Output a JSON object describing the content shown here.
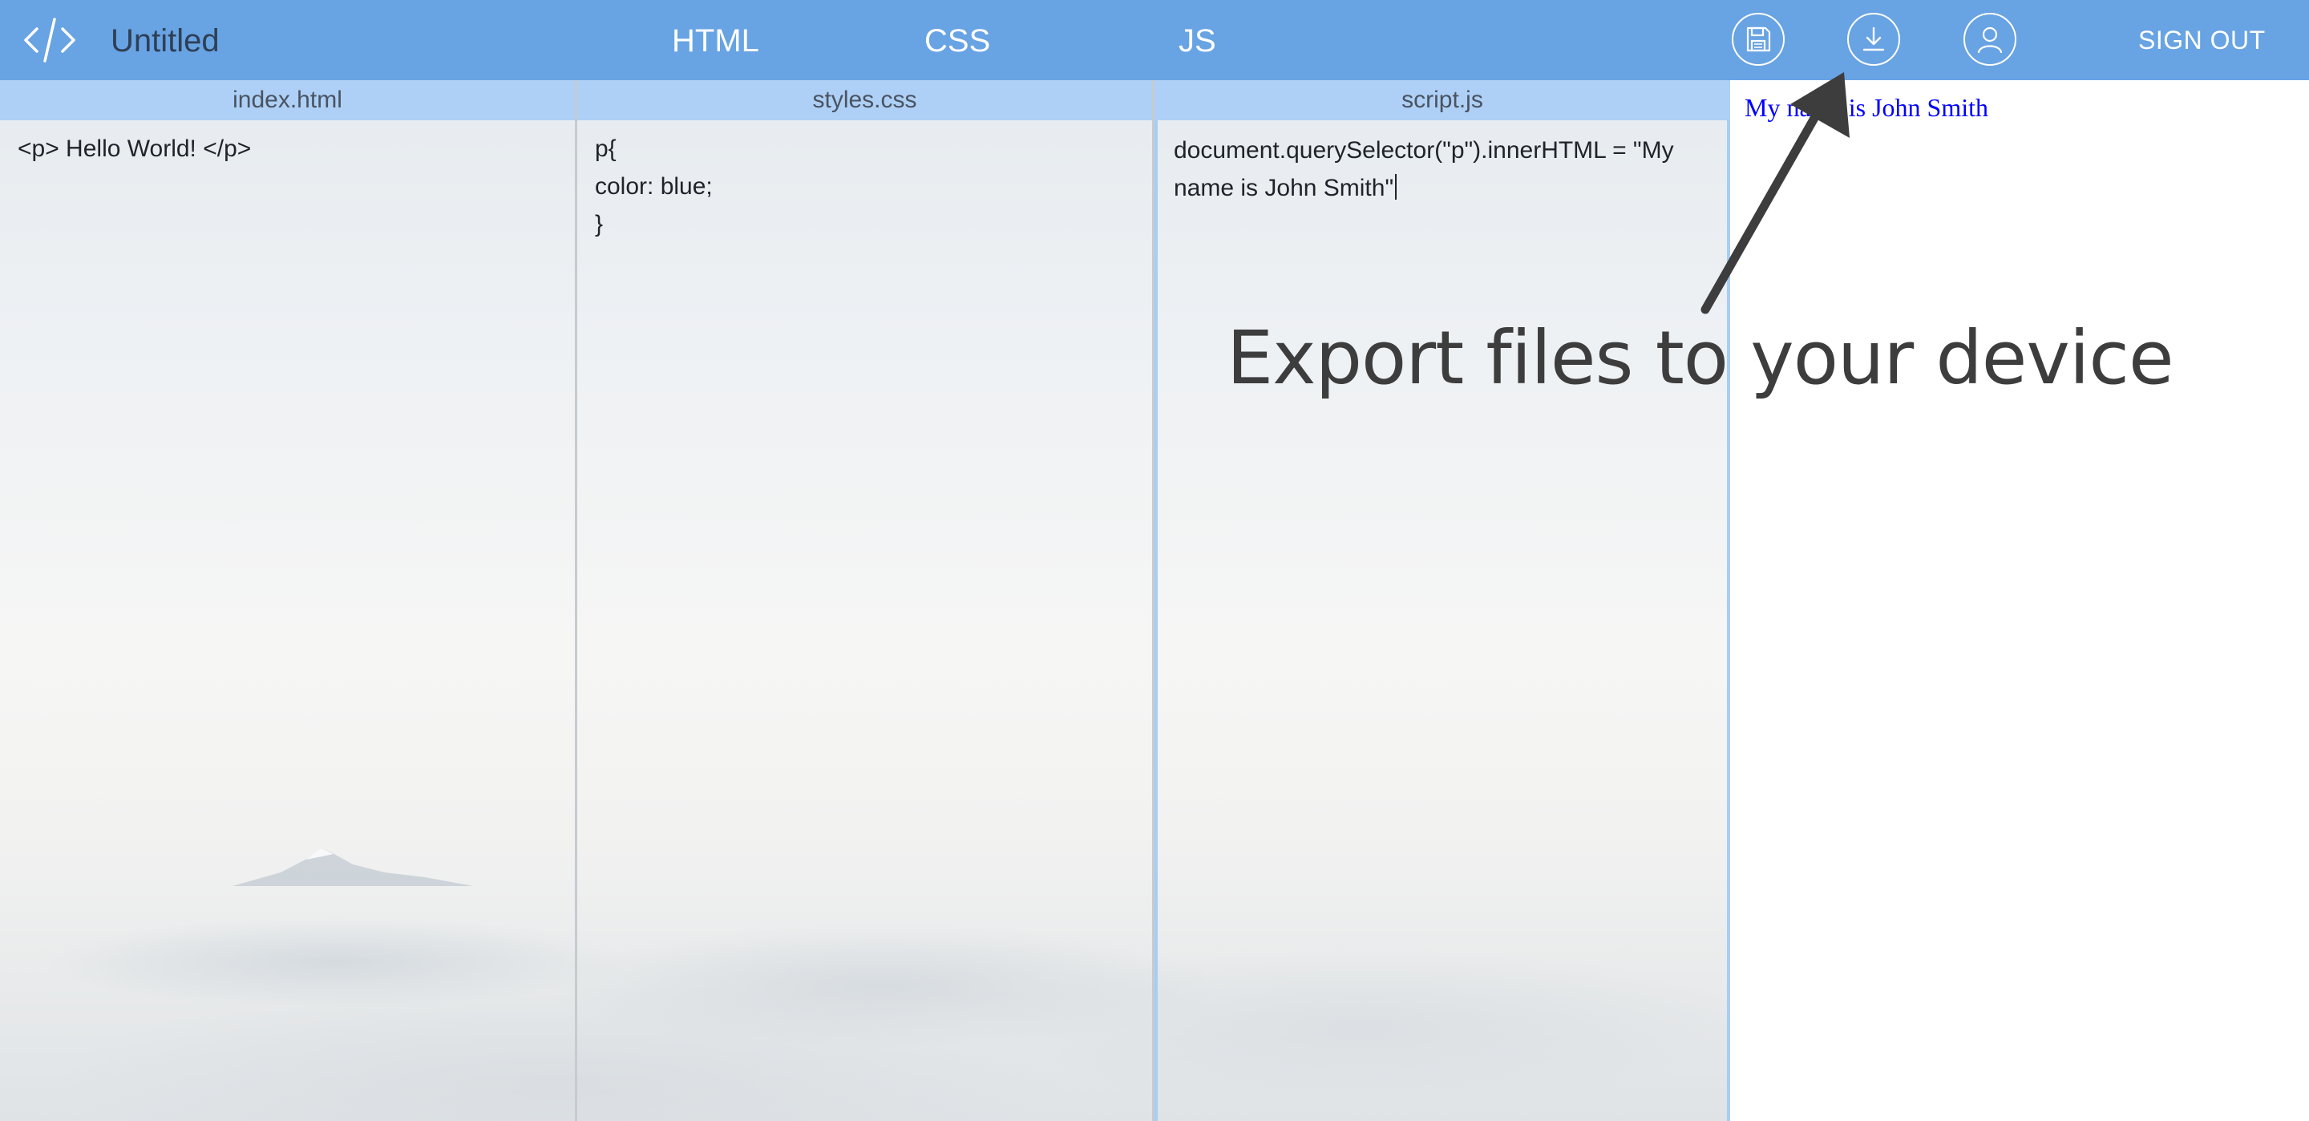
{
  "header": {
    "project_title": "Untitled",
    "nav": {
      "html_label": "HTML",
      "css_label": "CSS",
      "js_label": "JS"
    },
    "actions": {
      "save_icon": "floppy-disk-icon",
      "download_icon": "download-icon",
      "account_icon": "user-icon",
      "sign_out_label": "SIGN OUT"
    },
    "brand_color": "#68a3e3"
  },
  "editors": {
    "html": {
      "file_name": "index.html",
      "code": "<p> Hello World! </p>"
    },
    "css": {
      "file_name": "styles.css",
      "code": "p{\ncolor: blue;\n}"
    },
    "js": {
      "file_name": "script.js",
      "code": "document.querySelector(\"p\").innerHTML = \"My name is John Smith\""
    },
    "tab_color": "#aed0f6"
  },
  "preview": {
    "text": "My name is John Smith",
    "text_color": "#0000ff"
  },
  "annotation": {
    "text": "Export files to your device",
    "arrow_color": "#3d3d3d"
  }
}
